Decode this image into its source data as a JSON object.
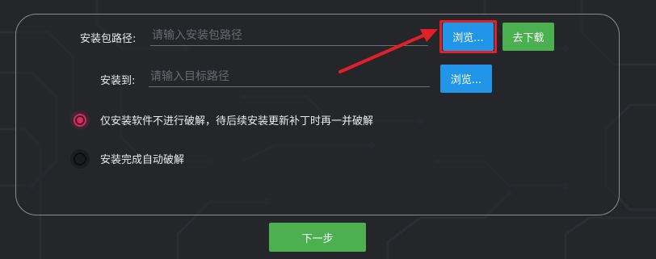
{
  "install_form": {
    "package_path": {
      "label": "安装包路径:",
      "placeholder": "请输入安装包路径",
      "value": "",
      "browse_label": "浏览...",
      "download_label": "去下载"
    },
    "install_to": {
      "label": "安装到:",
      "placeholder": "请输入目标路径",
      "value": "",
      "browse_label": "浏览..."
    },
    "crack_options": [
      {
        "label": "仅安装软件不进行破解，待后续安装更新补丁时再一并破解",
        "checked": true
      },
      {
        "label": "安装完成自动破解",
        "checked": false
      }
    ]
  },
  "footer": {
    "next_label": "下一步"
  },
  "colors": {
    "background": "#25262a",
    "accent_blue": "#2196e8",
    "accent_green": "#4caf50",
    "radio_checked": "#e8235f",
    "annotation_red": "#e3202a"
  }
}
